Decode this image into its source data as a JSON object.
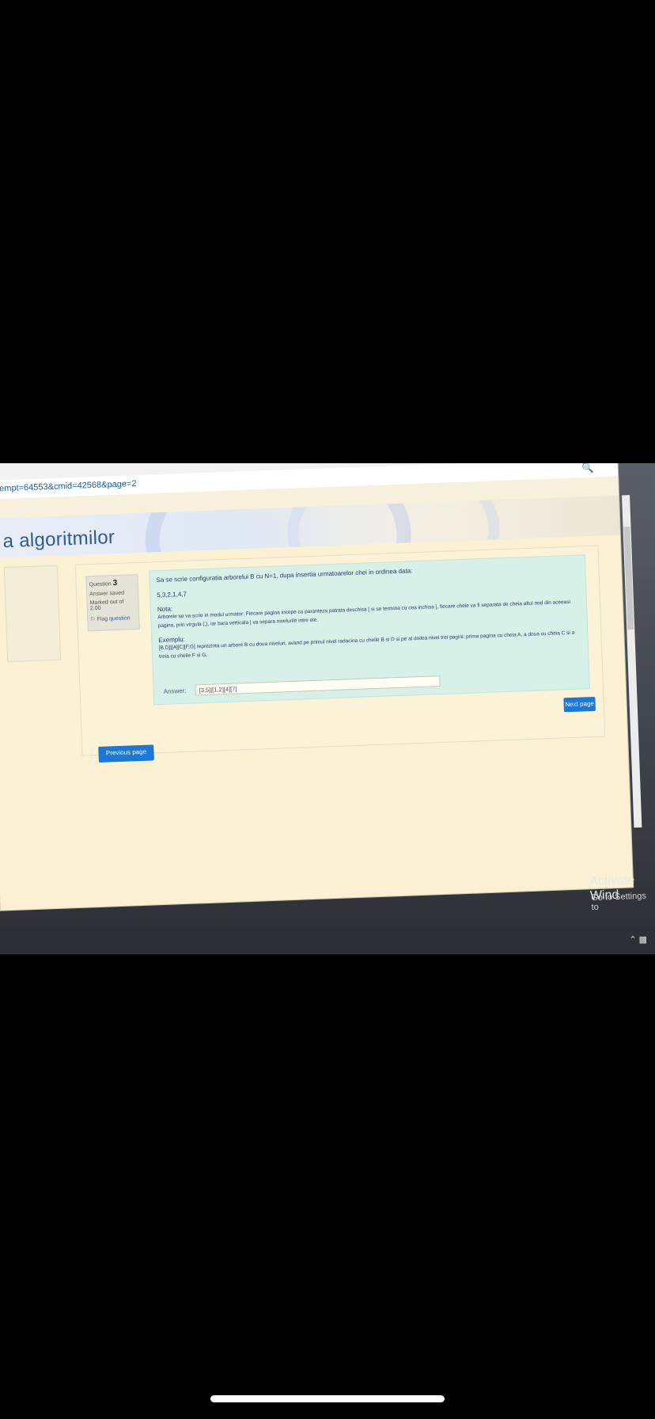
{
  "browser": {
    "url": "empt=64553&cmid=42568&page=2",
    "minimize_icon": "minimize-icon",
    "maximize_icon": "maximize-icon",
    "close_icon": "close-icon",
    "search_icon": "search-icon"
  },
  "site": {
    "title": "a algoritmilor"
  },
  "question": {
    "label": "Question",
    "number": "3",
    "status": "Answer saved",
    "marked": "Marked out of",
    "max_mark": "2.00",
    "flag_label": "Flag question",
    "text": "Sa se scrie configuratia arborelui B cu N=1, dupa insertia urmatoarelor chei in ordinea data:",
    "keys": "5,3,2,1,4,7",
    "note_heading": "Nota:",
    "note_text": "Arborele se va scrie in modul urmator: Fiecare pagina incepe cu paranteza patrata deschisa [ si se termina cu cea inchisa ], fiecare cheie va fi separata de cheia altui nod din aceeasi pagina, prin virgula (,), iar bara verticala | va separa nivelurile intre ele.",
    "example_heading": "Exemplu:",
    "example_text": "[B,D]|[A][C][F,G] reprezinta un arbore B cu doua niveluri, avand pe primul nivel radacina cu cheile B si D si pe al doilea nivel trei pagini: prima pagina cu cheia A, a doua cu cheia C si a treia cu cheile F si G.",
    "answer_label": "Answer:",
    "answer_value": "[3,5]|[1,2][4][7]"
  },
  "buttons": {
    "next": "Next page",
    "previous": "Previous page"
  },
  "os": {
    "activate_title": "Activate Wind",
    "activate_sub": "Go to Settings to",
    "tray_icon": "chevron-up-icon"
  }
}
